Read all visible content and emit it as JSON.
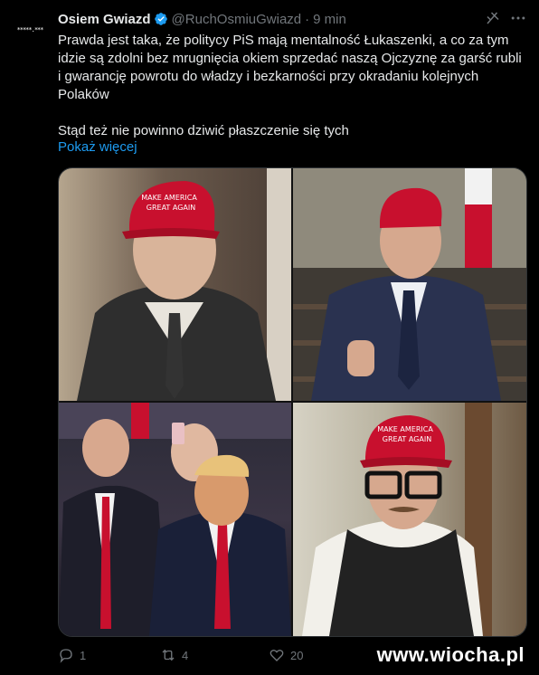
{
  "tweet": {
    "author_name": "Osiem Gwiazd",
    "handle": "@RuchOsmiuGwiazd",
    "separator": "·",
    "time": "9 min",
    "avatar_text": "*****.***",
    "text_p1": "Prawda jest taka, że politycy PiS mają mentalność Łukaszenki, a co za tym idzie są zdolni bez mrugnięcia okiem sprzedać naszą Ojczyznę za garść rubli i gwarancję powrotu do władzy i bezkarności przy okradaniu kolejnych Polaków",
    "text_p2": "Stąd też nie powinno dziwić płaszczenie się tych",
    "show_more": "Pokaż więcej",
    "cap_text": "MAKE AMERICA GREAT AGAIN"
  },
  "actions": {
    "replies": "1",
    "reposts": "4",
    "likes": "20"
  },
  "watermark": "www.wiocha.pl",
  "colors": {
    "accent": "#1d9bf0",
    "muted": "#71767b",
    "cap_red": "#c8102e"
  },
  "icons": [
    "verified-icon",
    "grok-icon",
    "more-icon",
    "reply-icon",
    "repost-icon",
    "like-icon"
  ]
}
